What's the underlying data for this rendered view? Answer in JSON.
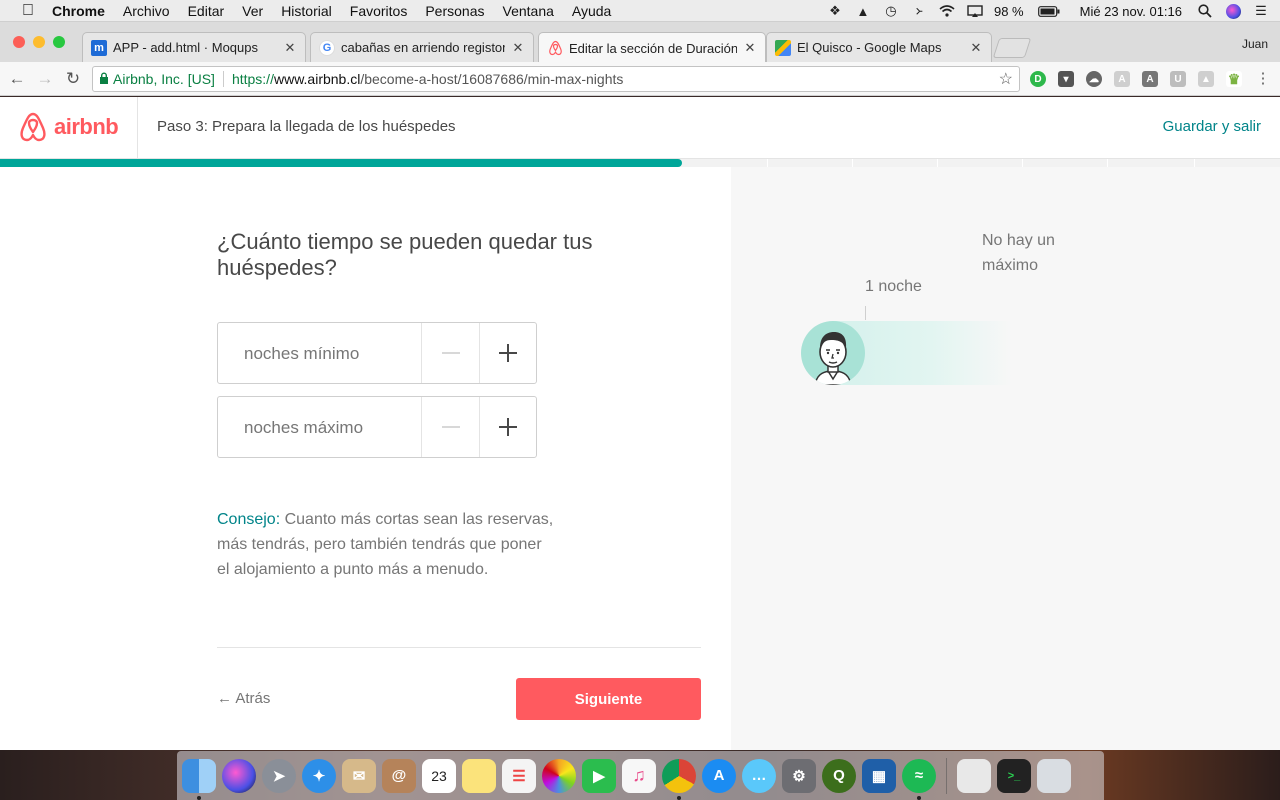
{
  "menubar": {
    "app_name": "Chrome",
    "menus": [
      "Archivo",
      "Editar",
      "Ver",
      "Historial",
      "Favoritos",
      "Personas",
      "Ventana",
      "Ayuda"
    ],
    "battery": "98 %",
    "datetime": "Mié 23 nov.  01:16"
  },
  "browser": {
    "profile": "Juan",
    "tabs": [
      {
        "title": "APP - add.html · Moqups",
        "favicon": "moqups-icon"
      },
      {
        "title": "cabañas en arriendo registor -",
        "favicon": "google-icon"
      },
      {
        "title": "Editar la sección de Duración d",
        "favicon": "airbnb-icon"
      },
      {
        "title": "El Quisco - Google Maps",
        "favicon": "google-maps-icon"
      }
    ],
    "site_identity": "Airbnb, Inc. [US]",
    "url_scheme": "https://",
    "url_host": "www.airbnb.cl",
    "url_path": "/become-a-host/16087686/min-max-nights"
  },
  "header": {
    "logo_text": "airbnb",
    "step_title": "Paso 3: Prepara la llegada de los huéspedes",
    "save_exit": "Guardar y salir",
    "progress": 0.533
  },
  "main": {
    "question": "¿Cuánto tiempo se pueden quedar tus huéspedes?",
    "min_nights_label": "noches mínimo",
    "max_nights_label": "noches máximo",
    "tip_label": "Consejo:",
    "tip_text": " Cuanto más cortas sean las reservas, más tendrás, pero también tendrás que poner el alojamiento a punto más a menudo.",
    "back_label": "Atrás",
    "next_label": "Siguiente"
  },
  "preview": {
    "min_label": "1 noche",
    "max_label": "No hay un máximo"
  },
  "colors": {
    "brand": "#ff5a5f",
    "teal": "#008489",
    "progress": "#00a699"
  },
  "dock": [
    "finder-icon",
    "siri-icon",
    "launchpad-icon",
    "safari-icon",
    "mail-icon",
    "contacts-icon",
    "calendar-icon",
    "notes-icon",
    "reminders-icon",
    "photos-icon",
    "facetime-icon",
    "itunes-icon",
    "chrome-icon",
    "app-store-icon",
    "messages-icon",
    "system-preferences-icon",
    "qgis-icon",
    "sourcetree-icon",
    "spotify-icon",
    "downloads-icon",
    "terminal-icon",
    "trash-icon"
  ],
  "dock_calendar_day": "23"
}
